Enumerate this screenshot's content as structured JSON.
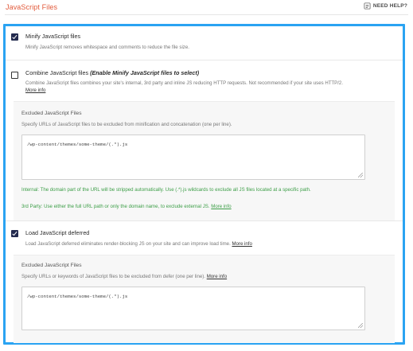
{
  "header": {
    "title": "JavaScript Files",
    "help_label": "NEED HELP?"
  },
  "options": [
    {
      "id": "minify",
      "checked": true,
      "label": "Minify JavaScript files",
      "description": "Minify JavaScript removes whitespace and comments to reduce the file size."
    },
    {
      "id": "combine",
      "checked": false,
      "label": "Combine JavaScript files",
      "label_note": "(Enable Minify JavaScript files to select)",
      "description": "Combine JavaScript files combines your site's internal, 3rd party and inline JS reducing HTTP requests. Not recommended if your site uses HTTP/2.",
      "more_info": "More info"
    },
    {
      "id": "defer",
      "checked": true,
      "label": "Load JavaScript deferred",
      "description": "Load JavaScript deferred eliminates render-blocking JS on your site and can improve load time.",
      "more_info": "More info"
    }
  ],
  "excluded_minify": {
    "title": "Excluded JavaScript Files",
    "description": "Specify URLs of JavaScript files to be excluded from minification and concatenation (one per line).",
    "value": "/wp-content/themes/some-theme/(.*).js",
    "note_internal": "Internal: The domain part of the URL will be stripped automatically. Use (.*).js wildcards to exclude all JS files located at a specific path.",
    "note_third_party": "3rd Party: Use either the full URL path or only the domain name, to exclude external JS.",
    "more_info": "More info"
  },
  "excluded_defer": {
    "title": "Excluded JavaScript Files",
    "description": "Specify URLs or keywords of JavaScript files to be excluded from defer (one per line).",
    "more_info": "More info",
    "value": "/wp-content/themes/some-theme/(.*).js"
  },
  "colors": {
    "accent_title": "#e25a3b",
    "frame_highlight": "#2aa3f2",
    "checkbox_checked": "#232a4e",
    "note_green": "#3c9e47"
  }
}
